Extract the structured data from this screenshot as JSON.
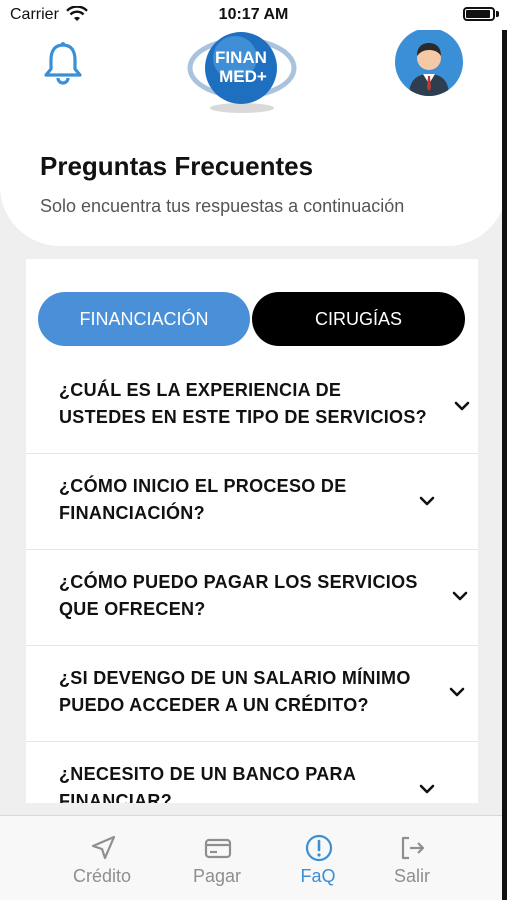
{
  "status_bar": {
    "carrier": "Carrier",
    "time": "10:17 AM"
  },
  "header": {
    "logo_line1": "FINAN",
    "logo_line2": "MED+",
    "title": "Preguntas Frecuentes",
    "subtitle": "Solo encuentra tus respuestas a continuación"
  },
  "tabs": [
    {
      "label": "FINANCIACIÓN",
      "active": true
    },
    {
      "label": "CIRUGÍAS",
      "active": false
    }
  ],
  "faq": [
    "¿CUÁL ES LA EXPERIENCIA DE USTEDES EN ESTE TIPO DE SERVICIOS?",
    "¿CÓMO INICIO EL  PROCESO DE FINANCIACIÓN?",
    "¿CÓMO PUEDO PAGAR LOS SERVICIOS QUE OFRECEN?",
    "¿SI DEVENGO DE UN SALARIO MÍNIMO PUEDO ACCEDER A UN CRÉDITO?",
    "¿NECESITO DE UN BANCO PARA FINANCIAR?"
  ],
  "nav": [
    {
      "label": "Crédito",
      "icon": "send-arrow-icon",
      "active": false
    },
    {
      "label": "Pagar",
      "icon": "credit-card-icon",
      "active": false
    },
    {
      "label": "FaQ",
      "icon": "exclamation-circle-icon",
      "active": true
    },
    {
      "label": "Salir",
      "icon": "logout-icon",
      "active": false
    }
  ],
  "colors": {
    "accent": "#4a90d9",
    "active_nav": "#3a8fd6",
    "dark_tab": "#000000",
    "inactive_nav": "#8e8e93"
  }
}
